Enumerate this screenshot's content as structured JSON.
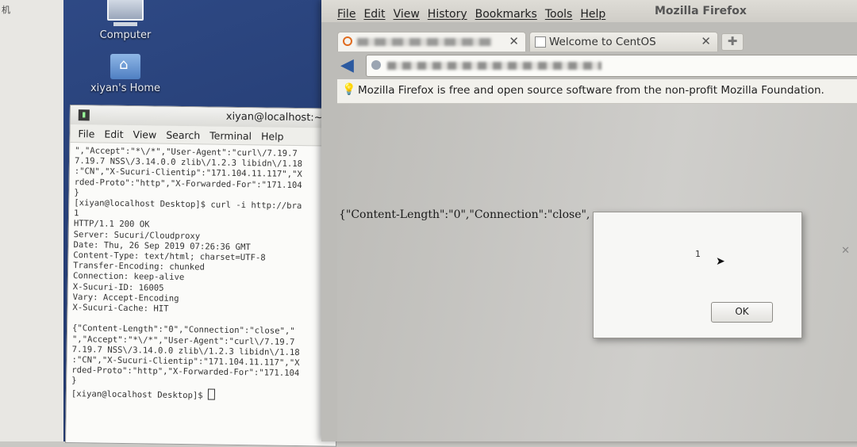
{
  "margin_char": "机",
  "desktop": {
    "icons": [
      {
        "label": "Computer"
      },
      {
        "label": "xiyan's Home"
      }
    ]
  },
  "terminal": {
    "title": "xiyan@localhost:~/D",
    "menu": [
      "File",
      "Edit",
      "View",
      "Search",
      "Terminal",
      "Help"
    ],
    "lines": [
      "\",\"Accept\":\"*\\/*\",\"User-Agent\":\"curl\\/7.19.7",
      "7.19.7 NSS\\/3.14.0.0 zlib\\/1.2.3 libidn\\/1.18",
      ":\"CN\",\"X-Sucuri-Clientip\":\"171.104.11.117\",\"X",
      "rded-Proto\":\"http\",\"X-Forwarded-For\":\"171.104",
      "}",
      "[xiyan@localhost Desktop]$ curl -i http://bra",
      "1",
      "HTTP/1.1 200 OK",
      "Server: Sucuri/Cloudproxy",
      "Date: Thu, 26 Sep 2019 07:26:36 GMT",
      "Content-Type: text/html; charset=UTF-8",
      "Transfer-Encoding: chunked",
      "Connection: keep-alive",
      "X-Sucuri-ID: 16005",
      "Vary: Accept-Encoding",
      "X-Sucuri-Cache: HIT",
      "",
      "{\"Content-Length\":\"0\",\"Connection\":\"close\",\"",
      "\",\"Accept\":\"*\\/*\",\"User-Agent\":\"curl\\/7.19.7",
      "7.19.7 NSS\\/3.14.0.0 zlib\\/1.2.3 libidn\\/1.18",
      ":\"CN\",\"X-Sucuri-Clientip\":\"171.104.11.117\",\"X",
      "rded-Proto\":\"http\",\"X-Forwarded-For\":\"171.104",
      "}"
    ],
    "prompt": "[xiyan@localhost Desktop]$ "
  },
  "firefox": {
    "app_title": "Mozilla Firefox",
    "menu": [
      "File",
      "Edit",
      "View",
      "History",
      "Bookmarks",
      "Tools",
      "Help"
    ],
    "tabs": [
      {
        "label": ""
      },
      {
        "label": "Welcome to CentOS"
      }
    ],
    "notice": "Mozilla Firefox is free and open source software from the non-profit Mozilla Foundation.",
    "page_text": "{\"Content-Length\":\"0\",\"Connection\":\"close\",",
    "dialog": {
      "message": "1",
      "ok_label": "OK"
    }
  }
}
